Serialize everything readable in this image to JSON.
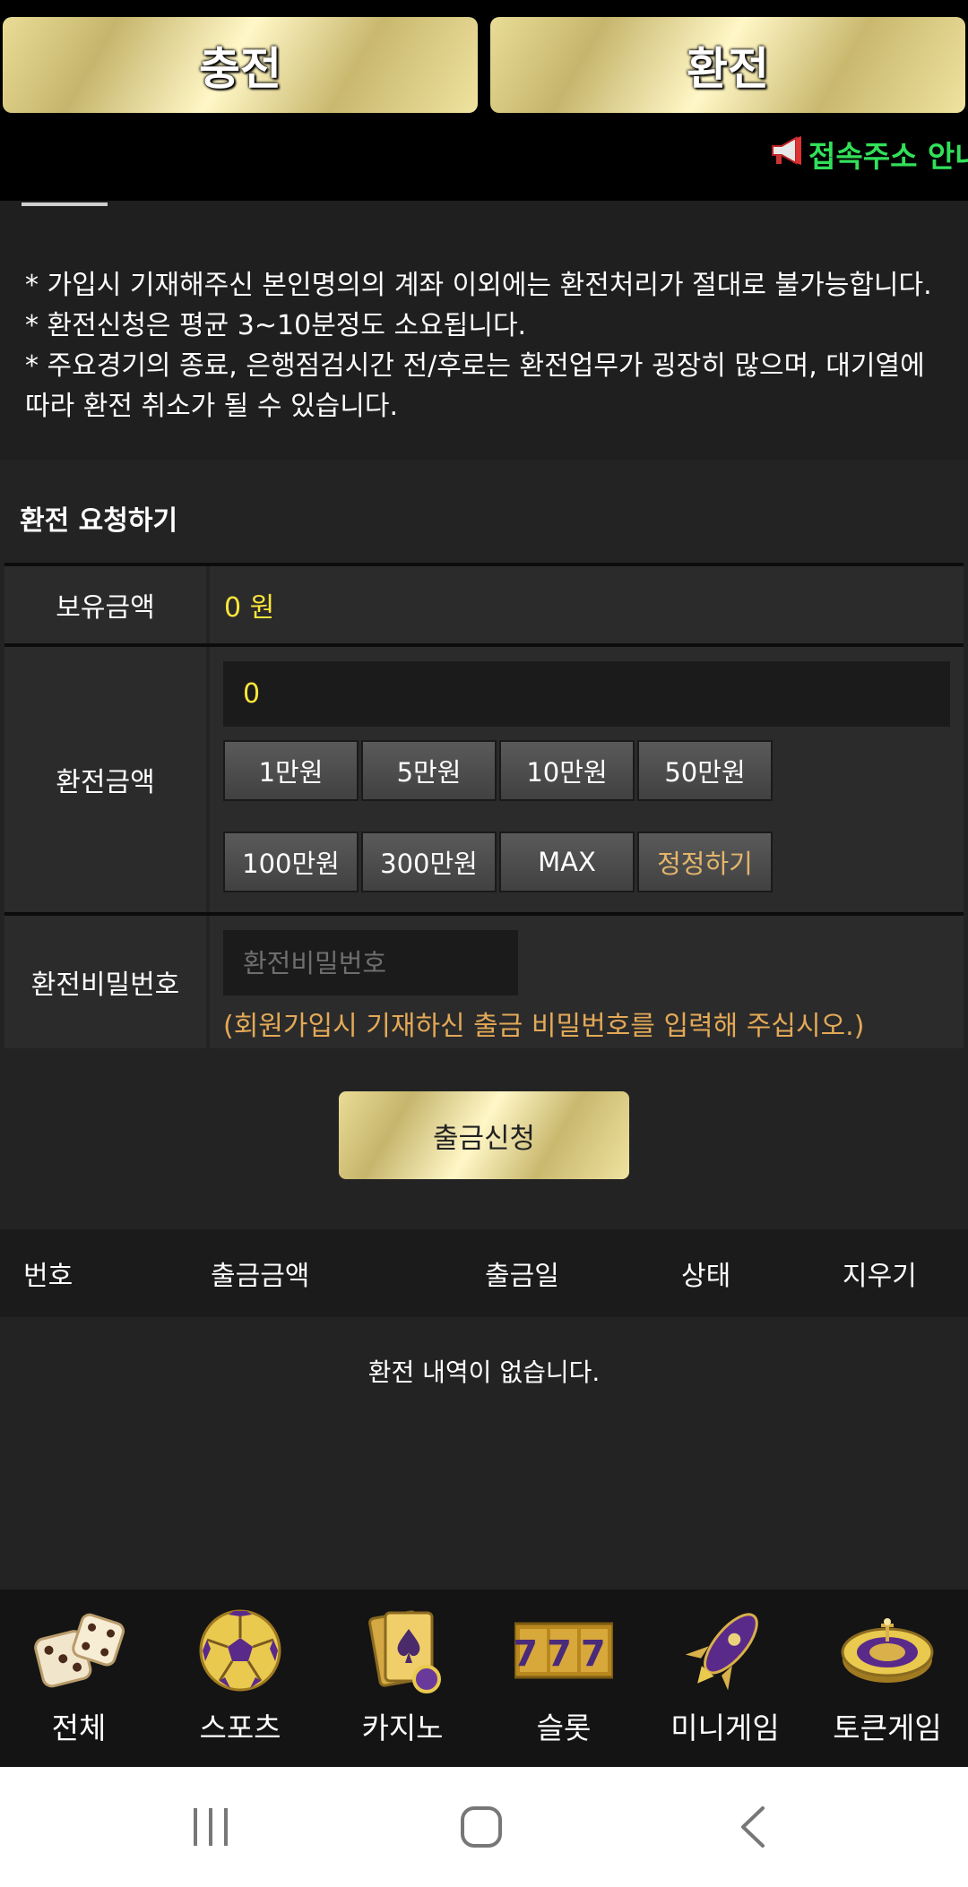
{
  "top_tabs": {
    "charge": "충전",
    "exchange": "환전"
  },
  "notice": {
    "icon": "megaphone-icon",
    "text": "접속주소 안내"
  },
  "info": {
    "lines": [
      "* 가입시 기재해주신 본인명의의 계좌 이외에는 환전처리가 절대로 불가능합니다.",
      "* 환전신청은 평균 3~10분정도 소요됩니다.",
      "* 주요경기의 종료, 은행점검시간 전/후로는 환전업무가 굉장히 많으며, 대기열에",
      "따라 환전 취소가 될 수 있습니다."
    ]
  },
  "request": {
    "title": "환전 요청하기",
    "balance_label": "보유금액",
    "balance_value": "0 원",
    "amount_label": "환전금액",
    "amount_value": "0",
    "amount_buttons": [
      "1만원",
      "5만원",
      "10만원",
      "50만원",
      "100만원",
      "300만원",
      "MAX",
      "정정하기"
    ],
    "password_label": "환전비밀번호",
    "password_placeholder": "환전비밀번호",
    "password_hint": "(회원가입시 기재하신 출금 비밀번호를 입력해 주십시오.)",
    "submit": "출금신청"
  },
  "history": {
    "columns": [
      "번호",
      "출금금액",
      "출금일",
      "상태",
      "지우기"
    ],
    "empty": "환전 내역이 없습니다."
  },
  "bottom_nav": [
    {
      "label": "전체",
      "icon": "dice-icon"
    },
    {
      "label": "스포츠",
      "icon": "soccer-ball-icon"
    },
    {
      "label": "카지노",
      "icon": "playing-cards-icon"
    },
    {
      "label": "슬롯",
      "icon": "slot-777-icon",
      "icon_text": "777"
    },
    {
      "label": "미니게임",
      "icon": "rocket-icon"
    },
    {
      "label": "토큰게임",
      "icon": "roulette-icon"
    }
  ],
  "colors": {
    "gold": "#d9c97f",
    "highlight_yellow": "#ffe63b",
    "notice_green": "#32e05a",
    "hint_orange": "#e3a957",
    "icon_purple": "#5a2a8a"
  }
}
